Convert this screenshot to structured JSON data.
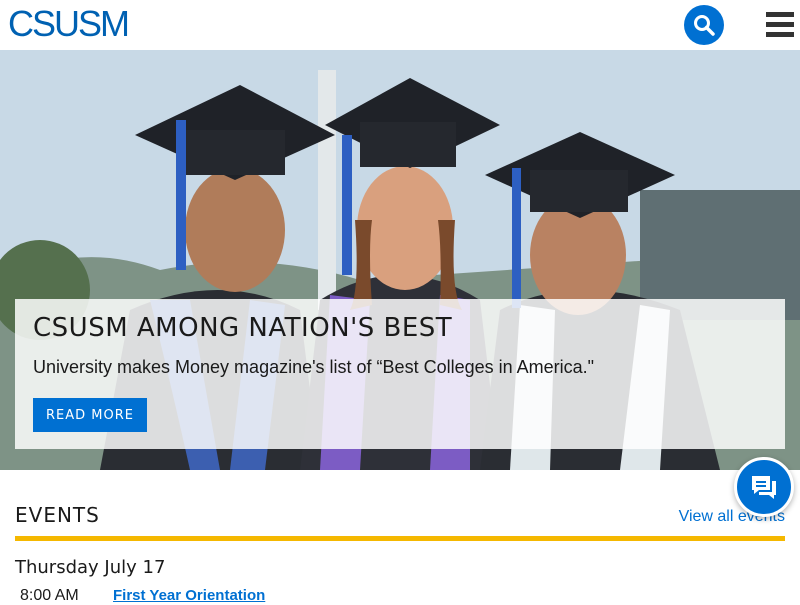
{
  "header": {
    "logo_text": "CSUSM",
    "search_icon": "search-icon",
    "menu_icon": "hamburger-menu-icon"
  },
  "hero": {
    "title": "CSUSM AMONG NATION'S BEST",
    "text": "University makes Money magazine's list of “Best Colleges in America.\"",
    "button_label": "READ MORE"
  },
  "events": {
    "title": "EVENTS",
    "view_all_label": "View all events",
    "items": [
      {
        "date": "Thursday July 17",
        "time": "8:00 AM",
        "title": "First Year Orientation"
      }
    ]
  },
  "chat": {
    "icon": "chat-icon"
  },
  "colors": {
    "brand_blue": "#0070d2",
    "logo_blue": "#0061b2",
    "accent_gold": "#f5b800"
  }
}
